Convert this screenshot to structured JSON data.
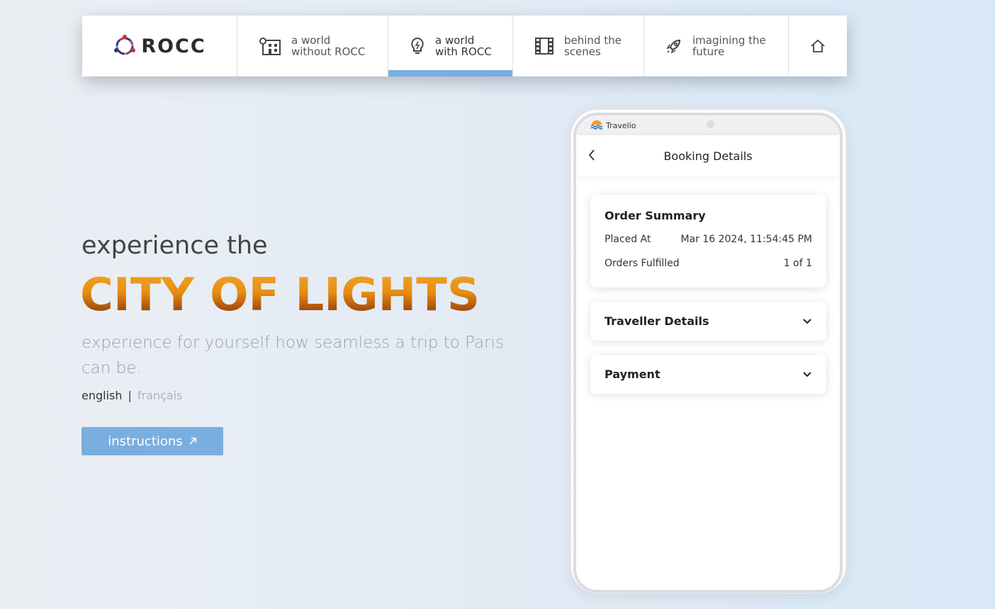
{
  "nav": {
    "logo": "ROCC",
    "items": [
      {
        "label": "a world\nwithout ROCC",
        "icon": "building-map-icon"
      },
      {
        "label": "a world\nwith ROCC",
        "icon": "lightbulb-icon",
        "active": true
      },
      {
        "label": "behind the\nscenes",
        "icon": "film-icon"
      },
      {
        "label": "imagining the\nfuture",
        "icon": "rocket-icon"
      }
    ],
    "home_icon": "home-icon"
  },
  "hero": {
    "pre": "experience the",
    "title": "CITY OF LIGHTS",
    "subtitle": "experience for yourself how seamless a trip to Paris can be.",
    "lang_en": "english",
    "lang_sep": "|",
    "lang_fr": "français",
    "button": "instructions"
  },
  "phone": {
    "brand": "Travelio",
    "title": "Booking Details",
    "order_summary": {
      "heading": "Order Summary",
      "placed_label": "Placed At",
      "placed_value": "Mar 16 2024, 11:54:45 PM",
      "fulfilled_label": "Orders Fulfilled",
      "fulfilled_value": "1 of 1"
    },
    "traveller": "Traveller Details",
    "payment": "Payment"
  },
  "colors": {
    "accent": "#7aaee0",
    "title_orange": "#e58e12",
    "title_brown": "#6a2c06"
  }
}
